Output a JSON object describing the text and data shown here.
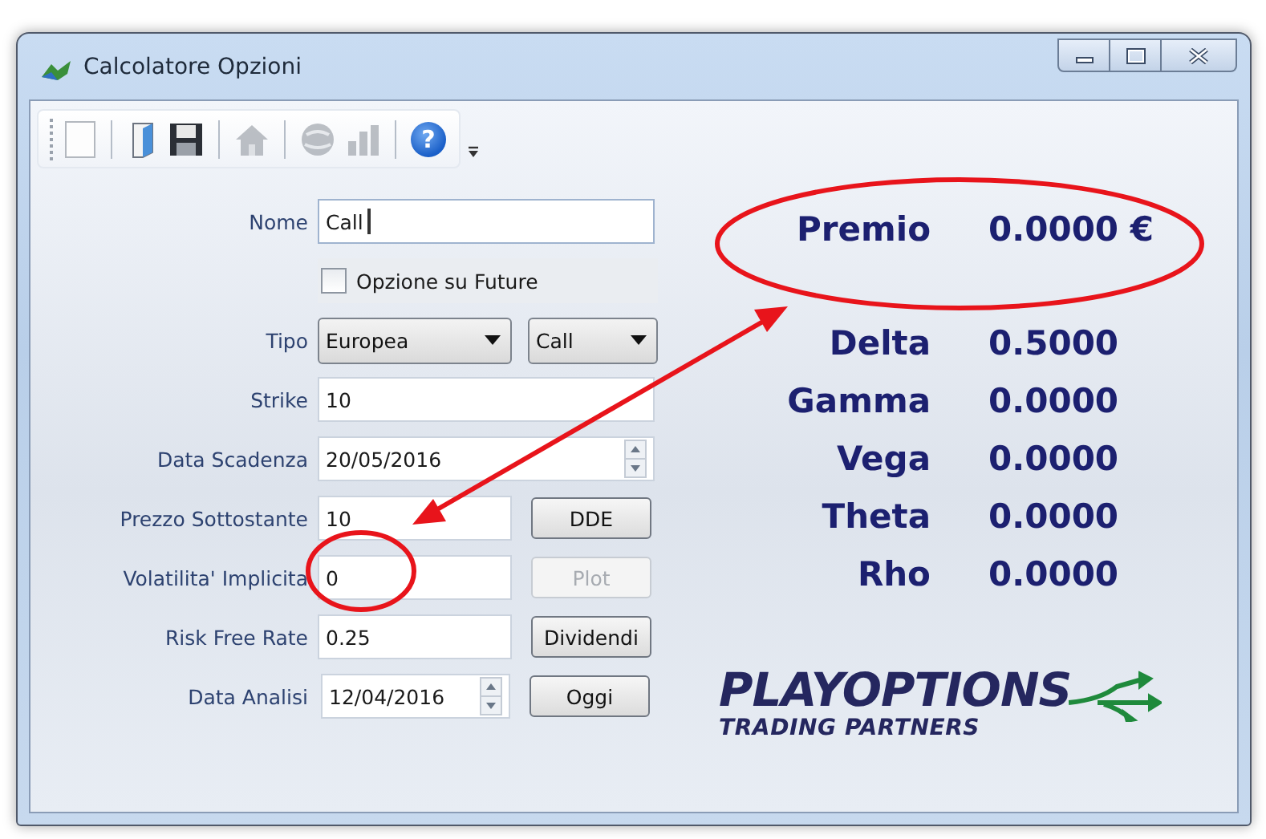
{
  "window": {
    "title": "Calcolatore Opzioni"
  },
  "toolbar": {
    "items": [
      {
        "kind": "grip",
        "disabled": false
      },
      {
        "kind": "new",
        "disabled": false
      },
      {
        "kind": "separator"
      },
      {
        "kind": "open",
        "disabled": false
      },
      {
        "kind": "save",
        "disabled": false
      },
      {
        "kind": "separator"
      },
      {
        "kind": "home",
        "disabled": true
      },
      {
        "kind": "separator"
      },
      {
        "kind": "globe",
        "disabled": true
      },
      {
        "kind": "chart",
        "disabled": true
      },
      {
        "kind": "separator"
      },
      {
        "kind": "help",
        "glyph": "?",
        "disabled": false
      }
    ]
  },
  "form": {
    "rows": [
      {
        "kind": "text",
        "label": "Nome",
        "value": "Call",
        "focused": true
      },
      {
        "kind": "check",
        "label": "Opzione su Future",
        "checked": false
      },
      {
        "kind": "selects",
        "label": "Tipo",
        "selects": [
          "Europea",
          "Call"
        ]
      },
      {
        "kind": "text",
        "label": "Strike",
        "value": "10",
        "focused": false
      },
      {
        "kind": "date",
        "label": "Data Scadenza",
        "value": "20/05/2016"
      },
      {
        "kind": "text-button",
        "label": "Prezzo Sottostante",
        "value": "10",
        "button": {
          "label": "DDE",
          "disabled": false
        }
      },
      {
        "kind": "text-button",
        "label": "Volatilita' Implicita",
        "value": "0",
        "button": {
          "label": "Plot",
          "disabled": true
        }
      },
      {
        "kind": "text-button",
        "label": "Risk Free Rate",
        "value": "0.25",
        "button": {
          "label": "Dividendi",
          "disabled": false
        }
      },
      {
        "kind": "date-button",
        "label": "Data Analisi",
        "value": "12/04/2016",
        "button": {
          "label": "Oggi",
          "disabled": false
        }
      }
    ]
  },
  "results": {
    "premium": {
      "label": "Premio",
      "value": "0.0000 €"
    },
    "greeks": [
      {
        "label": "Delta",
        "value": "0.5000"
      },
      {
        "label": "Gamma",
        "value": "0.0000"
      },
      {
        "label": "Vega",
        "value": "0.0000"
      },
      {
        "label": "Theta",
        "value": "0.0000"
      },
      {
        "label": "Rho",
        "value": "0.0000"
      }
    ]
  },
  "logo": {
    "name": "PLAYOPTIONS",
    "tagline": "TRADING PARTNERS"
  }
}
